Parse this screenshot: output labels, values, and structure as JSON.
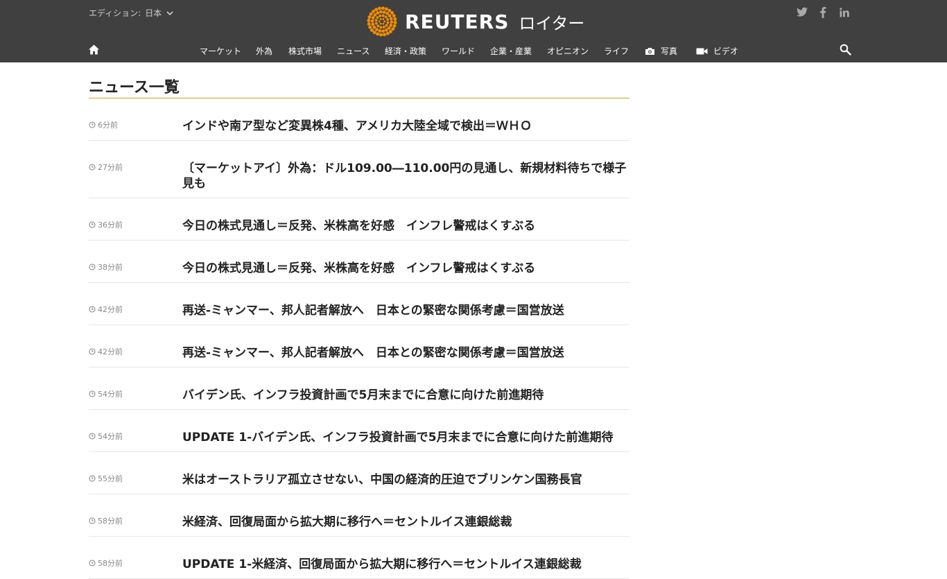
{
  "header": {
    "edition_label": "エディション:",
    "edition_value": "日本",
    "brand": "REUTERS",
    "brand_jp": "ロイター",
    "social": [
      "twitter-icon",
      "facebook-icon",
      "linkedin-icon"
    ],
    "colors": {
      "bar": "#404040",
      "accent": "#f08c00",
      "rule": "#d6a028"
    }
  },
  "nav": {
    "items": [
      {
        "label": "マーケット"
      },
      {
        "label": "外為"
      },
      {
        "label": "株式市場"
      },
      {
        "label": "ニュース"
      },
      {
        "label": "経済・政策"
      },
      {
        "label": "ワールド"
      },
      {
        "label": "企業・産業"
      },
      {
        "label": "オピニオン"
      },
      {
        "label": "ライフ"
      },
      {
        "label": "写真",
        "icon": "camera-icon"
      },
      {
        "label": "ビデオ",
        "icon": "video-camera-icon"
      }
    ]
  },
  "main": {
    "title": "ニュース一覧",
    "news": [
      {
        "time": "6分前",
        "headline": "インドや南ア型など変異株4種、アメリカ大陸全域で検出＝ＷＨＯ"
      },
      {
        "time": "27分前",
        "headline": "〔マーケットアイ〕外為：ドル109.00―110.00円の見通し、新規材料待ちで様子見も"
      },
      {
        "time": "36分前",
        "headline": "今日の株式見通し＝反発、米株高を好感　インフレ警戒はくすぶる"
      },
      {
        "time": "38分前",
        "headline": "今日の株式見通し＝反発、米株高を好感　インフレ警戒はくすぶる"
      },
      {
        "time": "42分前",
        "headline": "再送-ミャンマー、邦人記者解放へ　日本との緊密な関係考慮＝国営放送"
      },
      {
        "time": "42分前",
        "headline": "再送-ミャンマー、邦人記者解放へ　日本との緊密な関係考慮＝国営放送"
      },
      {
        "time": "54分前",
        "headline": "バイデン氏、インフラ投資計画で5月末までに合意に向けた前進期待"
      },
      {
        "time": "54分前",
        "headline": "UPDATE 1-バイデン氏、インフラ投資計画で5月末までに合意に向けた前進期待"
      },
      {
        "time": "55分前",
        "headline": "米はオーストラリア孤立させない、中国の経済的圧迫でブリンケン国務長官"
      },
      {
        "time": "58分前",
        "headline": "米経済、回復局面から拡大期に移行へ＝セントルイス連銀総裁"
      },
      {
        "time": "58分前",
        "headline": "UPDATE 1-米経済、回復局面から拡大期に移行へ＝セントルイス連銀総裁"
      }
    ]
  }
}
